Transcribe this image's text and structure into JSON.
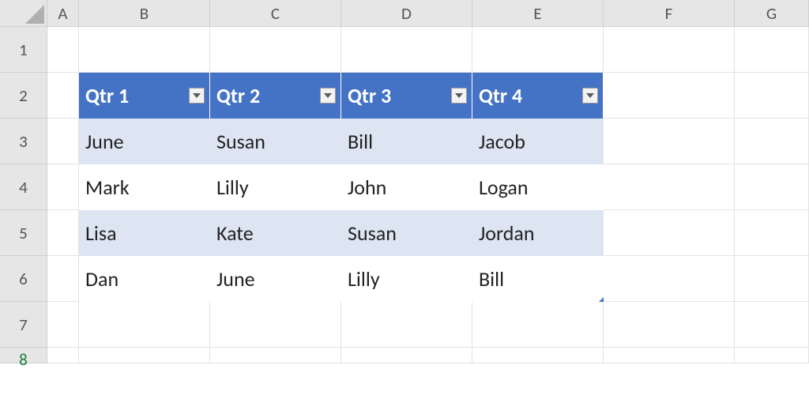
{
  "columns": [
    "A",
    "B",
    "C",
    "D",
    "E",
    "F",
    "G"
  ],
  "rows": [
    "1",
    "2",
    "3",
    "4",
    "5",
    "6",
    "7",
    "8"
  ],
  "active_row_index": 7,
  "table": {
    "headers": [
      "Qtr 1",
      "Qtr 2",
      "Qtr 3",
      "Qtr 4"
    ],
    "body": [
      [
        "June",
        "Susan",
        "Bill",
        "Jacob"
      ],
      [
        "Mark",
        "Lilly",
        "John",
        "Logan"
      ],
      [
        "Lisa",
        "Kate",
        "Susan",
        "Jordan"
      ],
      [
        "Dan",
        "June",
        "Lilly",
        "Bill"
      ]
    ]
  },
  "colors": {
    "table_header_bg": "#4472c4",
    "table_band_bg": "#dde5f3"
  }
}
